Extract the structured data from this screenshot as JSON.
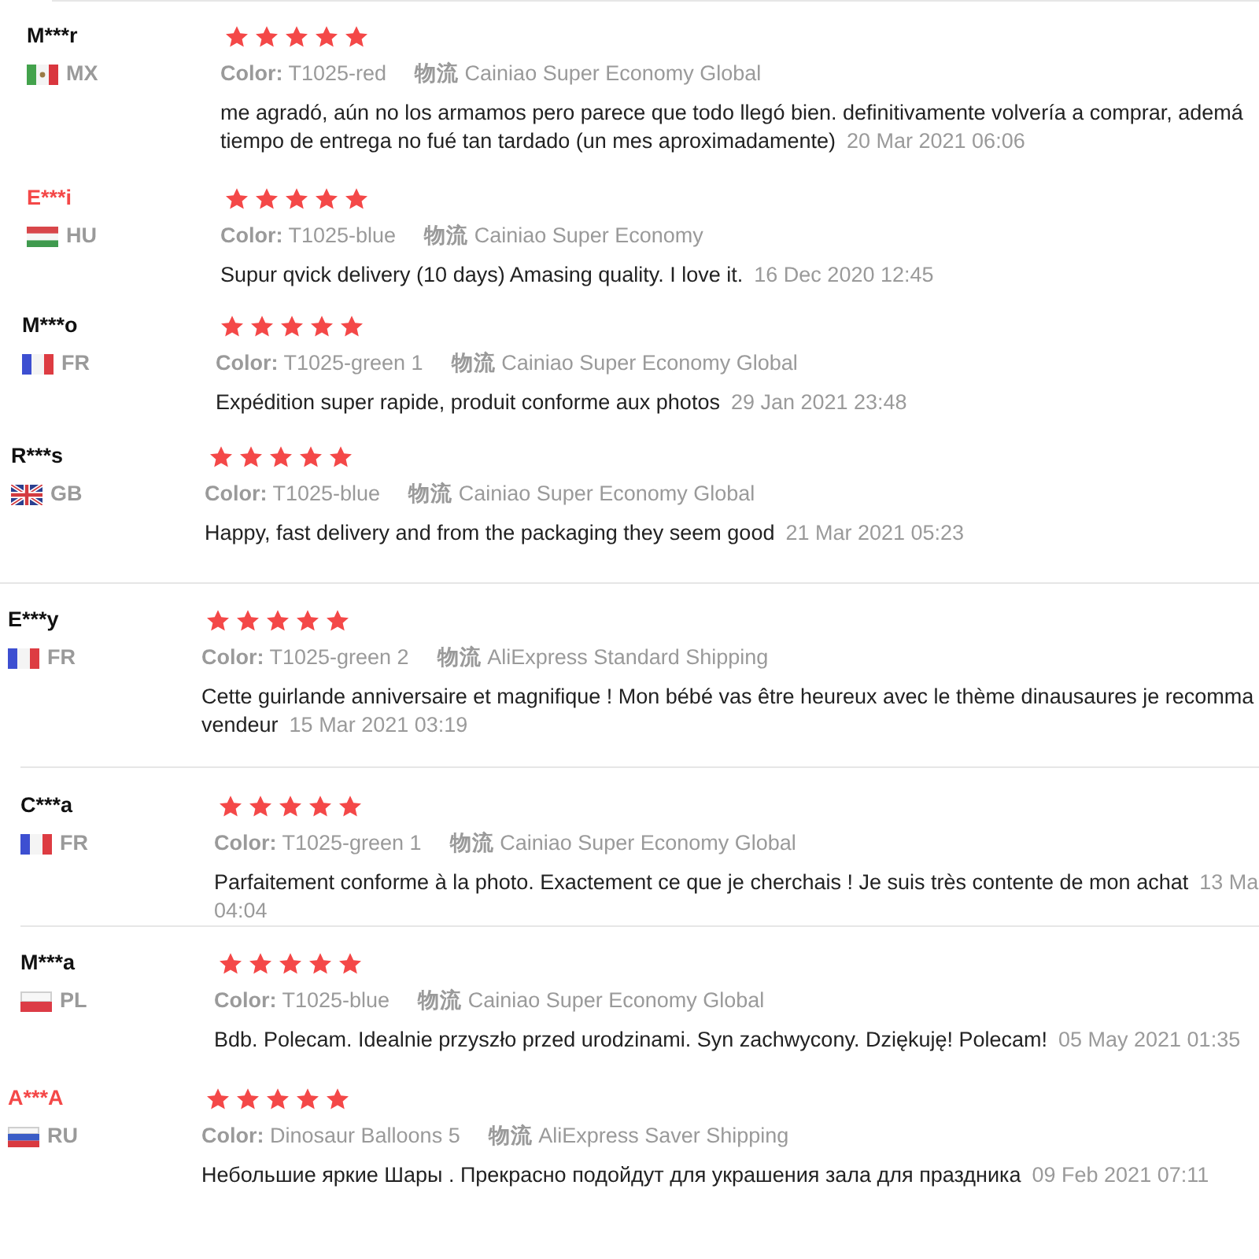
{
  "reviews": [
    {
      "name": "M***r",
      "color": "#111111",
      "flag": {
        "kind": "mx"
      },
      "country": "MX",
      "stars": 5,
      "attributes": [
        {
          "label": "Color:",
          "value": "T1025-red"
        },
        {
          "label": "物流",
          "value": "Cainiao Super Economy Global"
        }
      ],
      "comment": "me agradó, aún no los armamos pero parece que todo llegó bien. definitivamente volvería a comprar, ademá\ntiempo de entrega no fué tan tardado (un mes aproximadamente)",
      "date": "20 Mar 2021 06:06"
    },
    {
      "name": "E***i",
      "color": "#f44848",
      "flag": {
        "kind": "hu"
      },
      "country": "HU",
      "stars": 5,
      "attributes": [
        {
          "label": "Color:",
          "value": "T1025-blue"
        },
        {
          "label": "物流",
          "value": "Cainiao Super Economy"
        }
      ],
      "comment": "Supur qvick delivery (10 days) Amasing quality. I love it.",
      "date": "16 Dec 2020 12:45"
    },
    {
      "name": "M***o",
      "color": "#111111",
      "flag": {
        "kind": "fr"
      },
      "country": "FR",
      "stars": 5,
      "attributes": [
        {
          "label": "Color:",
          "value": "T1025-green 1"
        },
        {
          "label": "物流",
          "value": "Cainiao Super Economy Global"
        }
      ],
      "comment": "Expédition super rapide, produit conforme aux photos",
      "date": "29 Jan 2021 23:48"
    },
    {
      "name": "R***s",
      "color": "#111111",
      "flag": {
        "kind": "gb"
      },
      "country": "GB",
      "stars": 5,
      "attributes": [
        {
          "label": "Color:",
          "value": "T1025-blue"
        },
        {
          "label": "物流",
          "value": "Cainiao Super Economy Global"
        }
      ],
      "comment": "Happy, fast delivery and from the packaging they seem good",
      "date": "21 Mar 2021 05:23"
    },
    {
      "name": "E***y",
      "color": "#111111",
      "flag": {
        "kind": "fr"
      },
      "country": "FR",
      "stars": 5,
      "attributes": [
        {
          "label": "Color:",
          "value": "T1025-green 2"
        },
        {
          "label": "物流",
          "value": "AliExpress Standard Shipping"
        }
      ],
      "comment": "Cette guirlande anniversaire et magnifique ! Mon bébé vas être heureux avec le thème dinausaures je recomma\nvendeur",
      "date": "15 Mar 2021 03:19"
    },
    {
      "name": "C***a",
      "color": "#111111",
      "flag": {
        "kind": "fr"
      },
      "country": "FR",
      "stars": 5,
      "attributes": [
        {
          "label": "Color:",
          "value": "T1025-green 1"
        },
        {
          "label": "物流",
          "value": "Cainiao Super Economy Global"
        }
      ],
      "comment": "Parfaitement conforme à la photo. Exactement ce que je cherchais ! Je suis très contente de mon achat",
      "date": "13 Ma\n04:04"
    },
    {
      "name": "M***a",
      "color": "#111111",
      "flag": {
        "kind": "pl"
      },
      "country": "PL",
      "stars": 5,
      "attributes": [
        {
          "label": "Color:",
          "value": "T1025-blue"
        },
        {
          "label": "物流",
          "value": "Cainiao Super Economy Global"
        }
      ],
      "comment": "Bdb. Polecam. Idealnie przyszło przed urodzinami. Syn zachwycony. Dziękuję! Polecam!",
      "date": "05 May 2021 01:35"
    },
    {
      "name": "A***A",
      "color": "#f44848",
      "flag": {
        "kind": "ru"
      },
      "country": "RU",
      "stars": 5,
      "attributes": [
        {
          "label": "Color:",
          "value": "Dinosaur Balloons 5"
        },
        {
          "label": "物流",
          "value": "AliExpress Saver Shipping"
        }
      ],
      "comment": "Небольшие яркие Шары . Прекрасно подойдут для украшения зала для праздника",
      "date": "09 Feb 2021 07:11"
    }
  ]
}
